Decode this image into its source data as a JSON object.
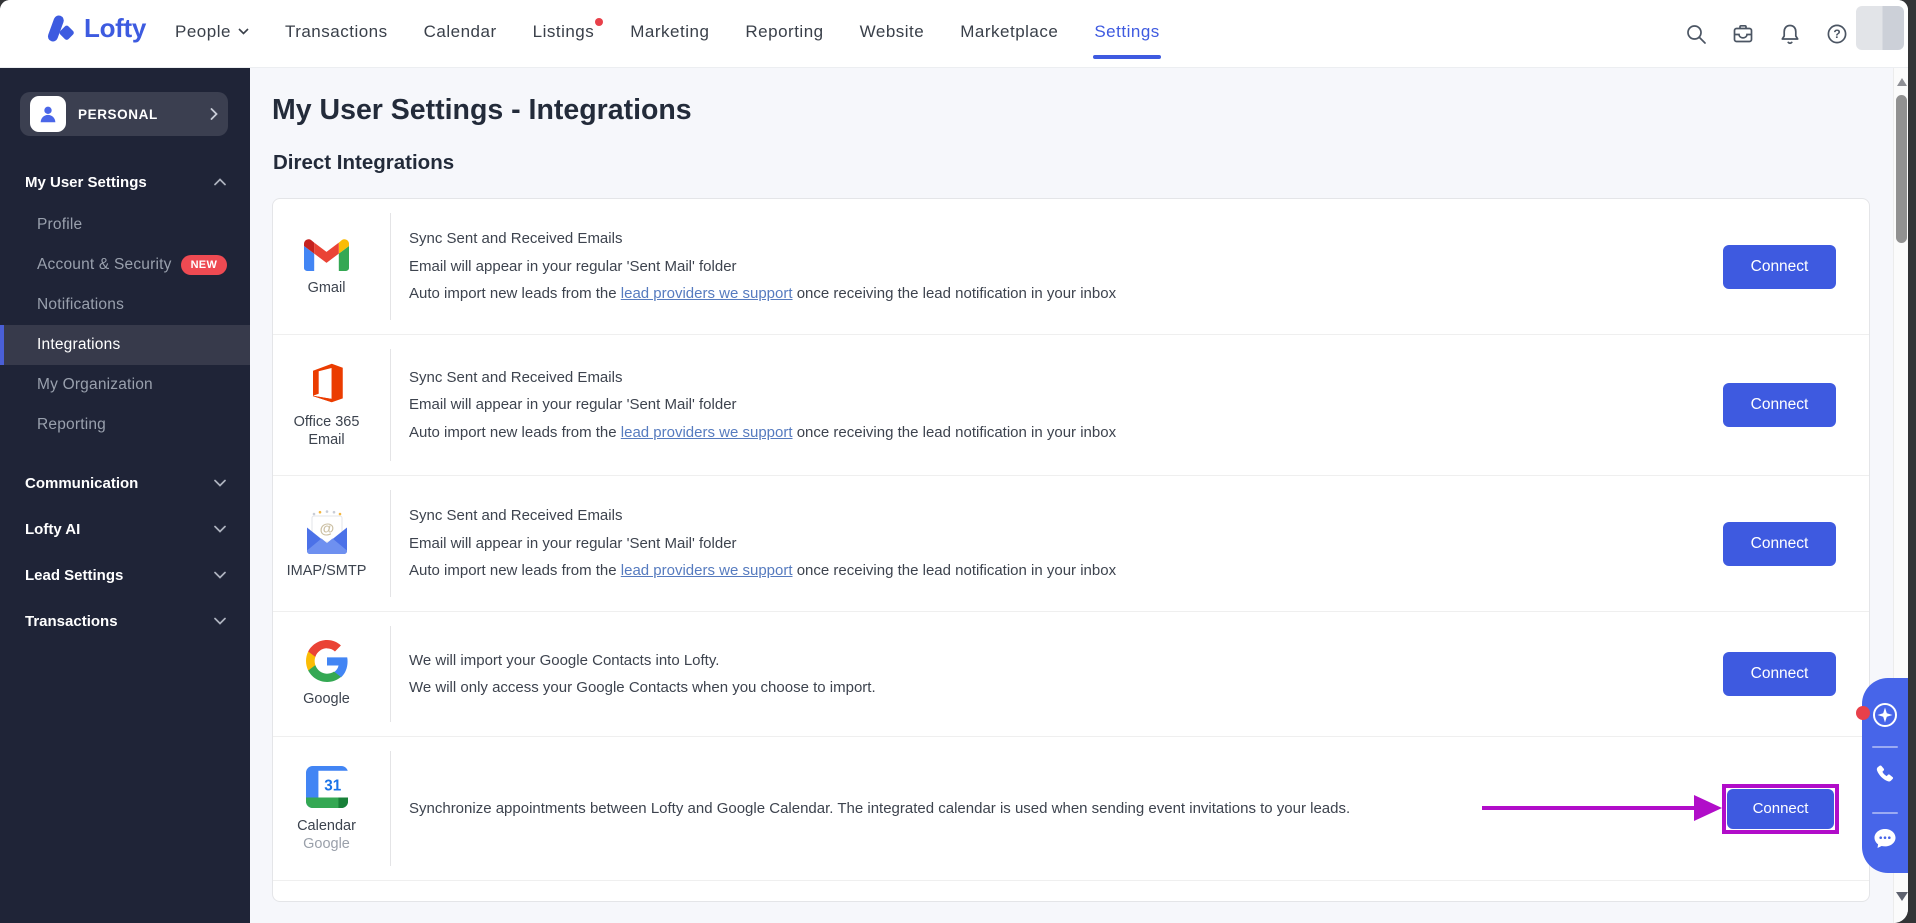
{
  "brand": {
    "name": "Lofty"
  },
  "topnav": {
    "items": [
      "People",
      "Transactions",
      "Calendar",
      "Listings",
      "Marketing",
      "Reporting",
      "Website",
      "Marketplace",
      "Settings"
    ],
    "active": "Settings",
    "listings_has_notification_dot": true
  },
  "topbar_icons": [
    "search-icon",
    "inbox-icon",
    "notifications-icon",
    "help-icon"
  ],
  "sidebar": {
    "account_label": "PERSONAL",
    "sections": [
      {
        "label": "My User Settings",
        "expanded": true,
        "items": [
          {
            "label": "Profile"
          },
          {
            "label": "Account & Security",
            "badge": "NEW"
          },
          {
            "label": "Notifications"
          },
          {
            "label": "Integrations",
            "selected": true
          },
          {
            "label": "My Organization"
          },
          {
            "label": "Reporting"
          }
        ]
      },
      {
        "label": "Communication",
        "expanded": false
      },
      {
        "label": "Lofty AI",
        "expanded": false
      },
      {
        "label": "Lead Settings",
        "expanded": false
      },
      {
        "label": "Transactions",
        "expanded": false
      }
    ]
  },
  "page": {
    "title": "My User Settings - Integrations",
    "section_title": "Direct Integrations"
  },
  "integrations": {
    "connect_label": "Connect",
    "rows": [
      {
        "name": "Gmail",
        "icon": "gmail-icon",
        "label": "Gmail",
        "line1": "Sync Sent and Received Emails",
        "line2": "Email will appear in your regular 'Sent Mail' folder",
        "line3_pre": "Auto import new leads from the ",
        "line3_link": "lead providers we support",
        "line3_post": " once receiving the lead notification in your inbox"
      },
      {
        "name": "Office 365 Email",
        "icon": "office365-icon",
        "label": "Office 365",
        "label2": "Email",
        "line1": "Sync Sent and Received Emails",
        "line2": "Email will appear in your regular 'Sent Mail' folder",
        "line3_pre": "Auto import new leads from the ",
        "line3_link": "lead providers we support",
        "line3_post": " once receiving the lead notification in your inbox"
      },
      {
        "name": "IMAP/SMTP",
        "icon": "imap-smtp-icon",
        "label": "IMAP/SMTP",
        "line1": "Sync Sent and Received Emails",
        "line2": "Email will appear in your regular 'Sent Mail' folder",
        "line3_pre": "Auto import new leads from the ",
        "line3_link": "lead providers we support",
        "line3_post": " once receiving the lead notification in your inbox"
      },
      {
        "name": "Google",
        "icon": "google-icon",
        "label": "Google",
        "line1": "We will import your Google Contacts into Lofty.",
        "line2": "We will only access your Google Contacts when you choose to import."
      },
      {
        "name": "Calendar Google",
        "icon": "google-calendar-icon",
        "label": "Calendar",
        "label2": "Google",
        "line1": "Synchronize appointments between Lofty and Google Calendar. The integrated calendar is used when sending event invitations to your leads.",
        "highlighted": true
      }
    ]
  },
  "annotation": {
    "arrow_color": "#b10dc9"
  },
  "widget_icons": [
    "sparkle-icon",
    "phone-icon",
    "chat-icon"
  ],
  "colors": {
    "accent": "#3e5ae0",
    "sidebar_bg": "#1f2437",
    "badge_red": "#ee4a52",
    "highlight": "#b10dc9",
    "widget_blue": "#4765e9"
  }
}
